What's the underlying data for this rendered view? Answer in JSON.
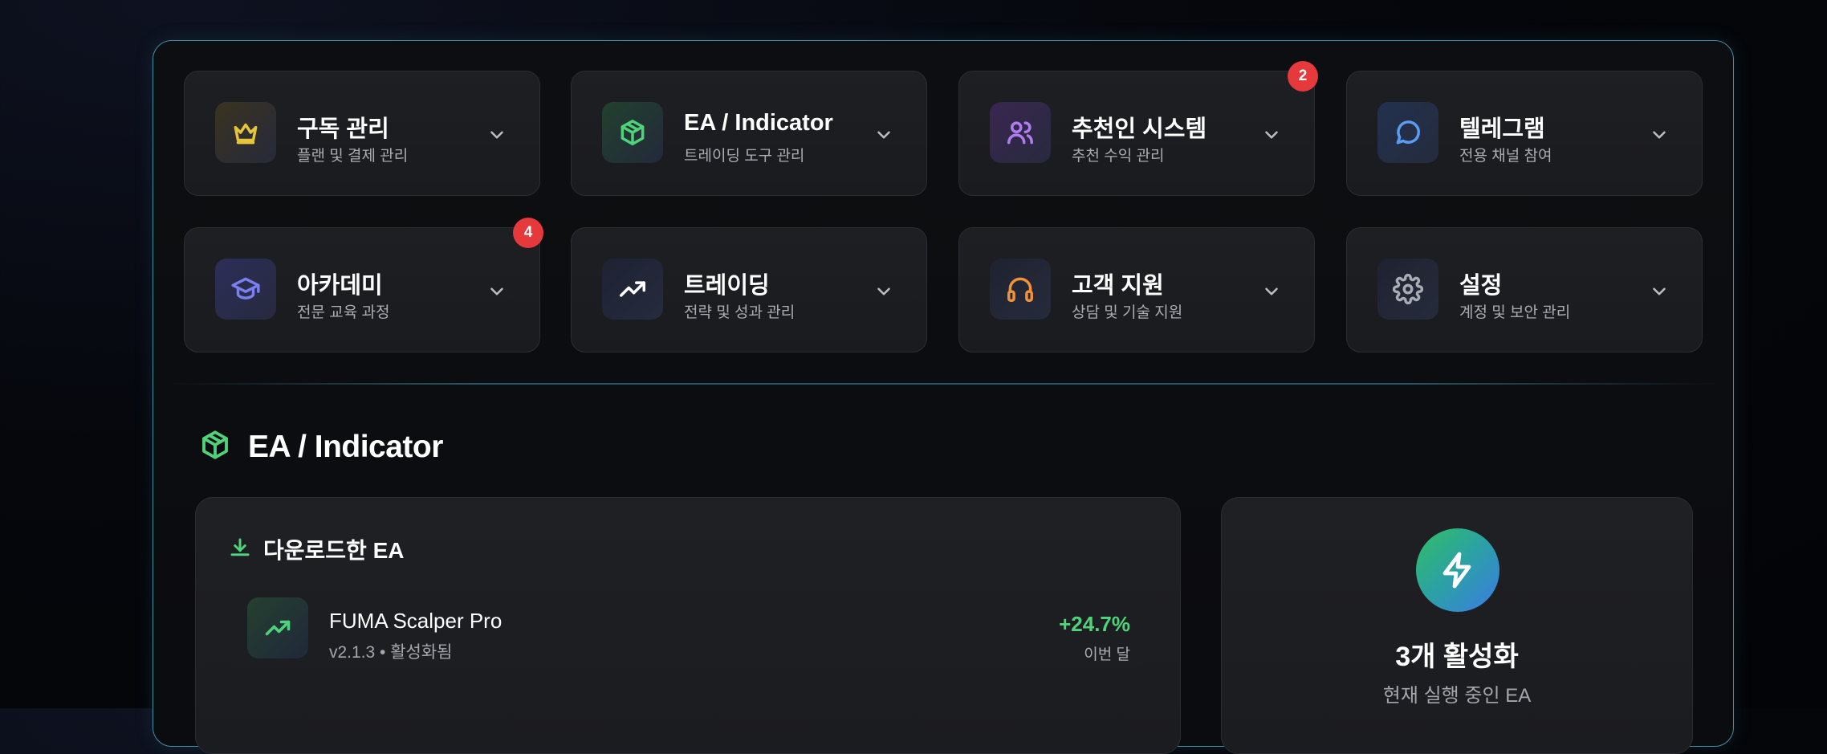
{
  "colors": {
    "accent_border": "#3f8fa3",
    "green": "#4fd27a",
    "badge_red": "#e5393c"
  },
  "menu": {
    "cards": [
      {
        "title": "구독 관리",
        "subtitle": "플랜 및 결제 관리",
        "icon": "crown-icon",
        "icon_color": "#e6c53a"
      },
      {
        "title": "EA / Indicator",
        "subtitle": "트레이딩 도구 관리",
        "icon": "box-icon",
        "icon_color": "#4fd27a"
      },
      {
        "title": "추천인 시스템",
        "subtitle": "추천 수익 관리",
        "icon": "users-icon",
        "icon_color": "#b07cf0",
        "badge": "2"
      },
      {
        "title": "텔레그램",
        "subtitle": "전용 채널 참여",
        "icon": "chat-icon",
        "icon_color": "#5b9cf2"
      },
      {
        "title": "아카데미",
        "subtitle": "전문 교육 과정",
        "icon": "graduation-cap-icon",
        "icon_color": "#7a80f0",
        "badge": "4"
      },
      {
        "title": "트레이딩",
        "subtitle": "전략 및 성과 관리",
        "icon": "trending-up-icon",
        "icon_color": "#ffffff"
      },
      {
        "title": "고객 지원",
        "subtitle": "상담 및 기술 지원",
        "icon": "headphones-icon",
        "icon_color": "#f0923a"
      },
      {
        "title": "설정",
        "subtitle": "계정 및 보안 관리",
        "icon": "gear-icon",
        "icon_color": "#a9acb3"
      }
    ]
  },
  "section": {
    "title": "EA / Indicator",
    "icon": "box-icon"
  },
  "downloads": {
    "title": "다운로드한 EA",
    "icon": "download-icon",
    "items": [
      {
        "name": "FUMA Scalper Pro",
        "meta": "v2.1.3 • 활성화됨",
        "performance": "+24.7%",
        "period": "이번 달",
        "icon": "trending-up-icon"
      }
    ]
  },
  "active": {
    "title": "3개 활성화",
    "subtitle": "현재 실행 중인 EA",
    "icon": "lightning-icon"
  }
}
